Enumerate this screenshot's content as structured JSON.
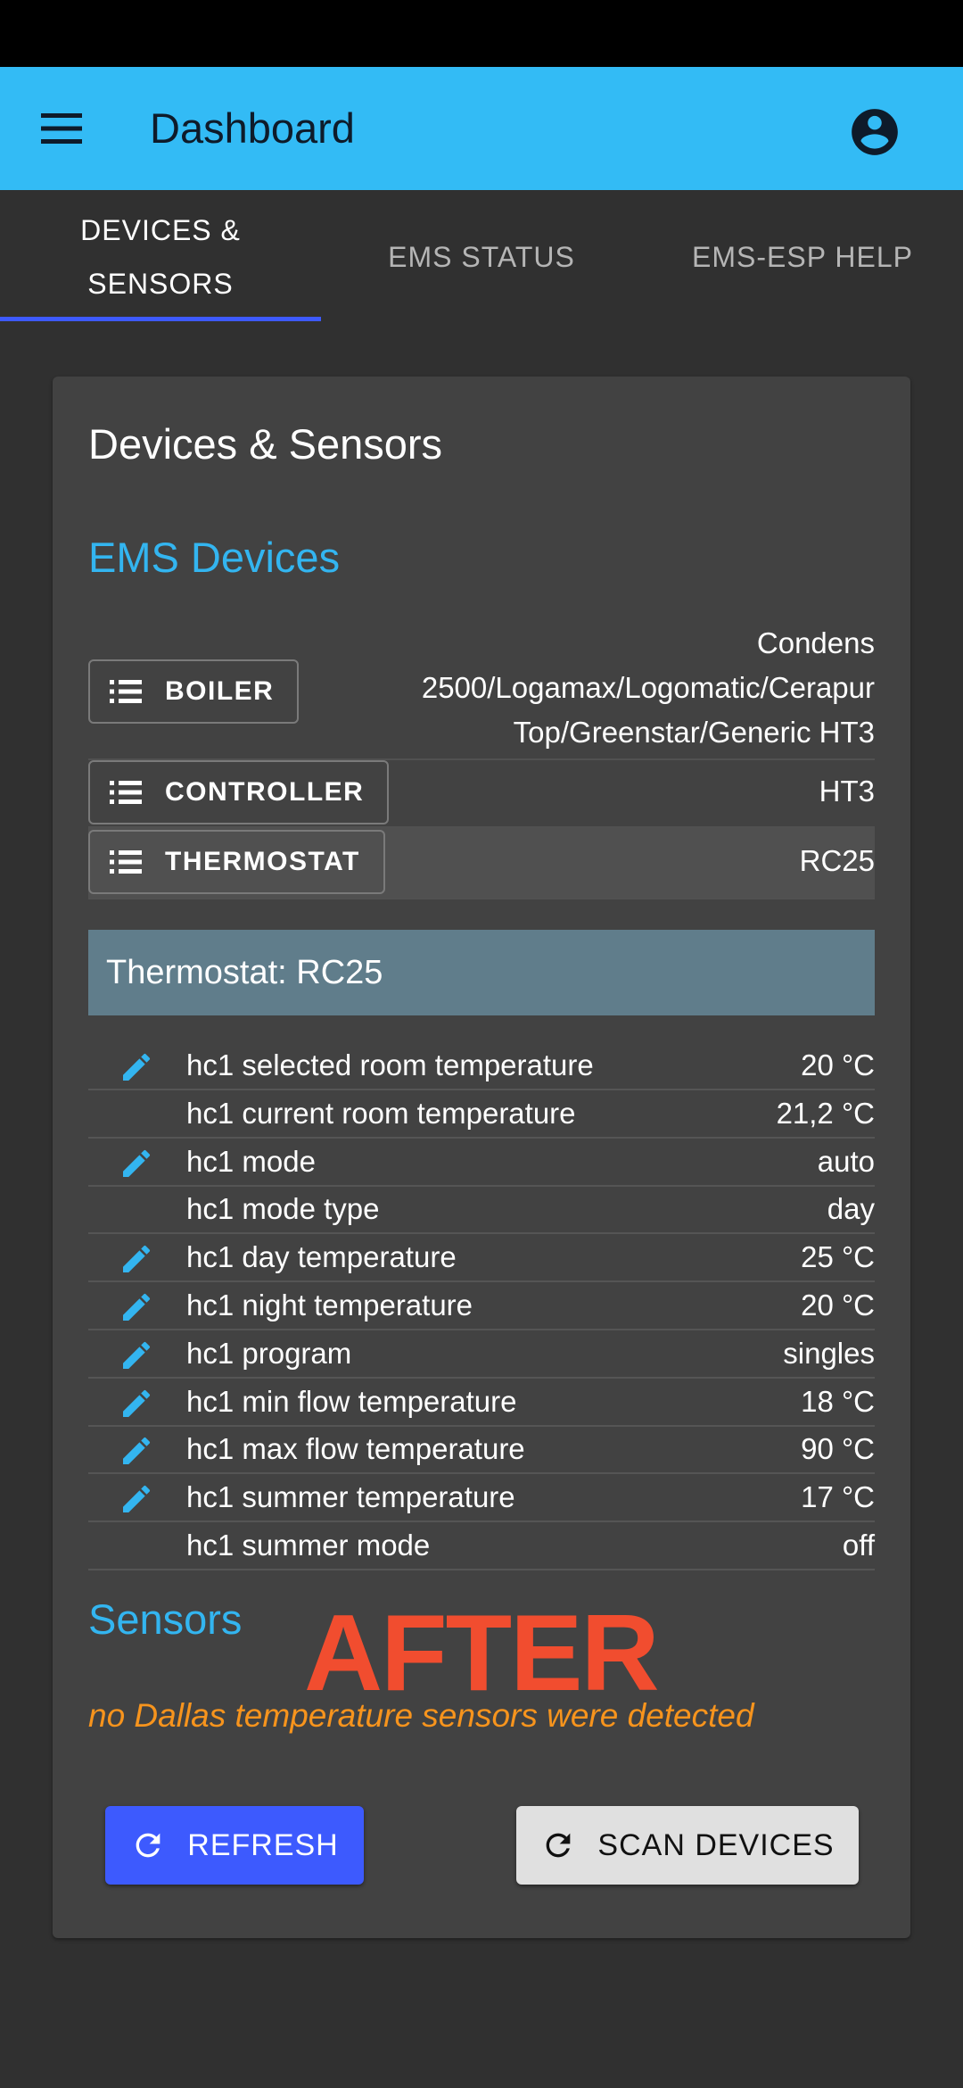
{
  "app_bar": {
    "title": "Dashboard",
    "menu_icon": "menu-icon",
    "account_icon": "account-circle-icon",
    "color": "#33bbf5"
  },
  "tabs": [
    {
      "label_line1": "DEVICES &",
      "label_line2": "SENSORS",
      "active": true
    },
    {
      "label": "EMS STATUS",
      "active": false
    },
    {
      "label": "EMS-ESP HELP",
      "active": false
    }
  ],
  "card": {
    "title": "Devices & Sensors",
    "ems_devices_title": "EMS Devices",
    "devices": [
      {
        "button": "BOILER",
        "name_lines": [
          "Condens",
          "2500/Logamax/Logomatic/Cerapur",
          "Top/Greenstar/Generic HT3"
        ]
      },
      {
        "button": "CONTROLLER",
        "name_lines": [
          "HT3"
        ]
      },
      {
        "button": "THERMOSTAT",
        "name_lines": [
          "RC25"
        ],
        "selected": true
      }
    ],
    "thermostat_header": "Thermostat: RC25",
    "parameters": [
      {
        "name": "hc1 selected room temperature",
        "value": "20 °C",
        "editable": true
      },
      {
        "name": "hc1 current room temperature",
        "value": "21,2 °C",
        "editable": false
      },
      {
        "name": "hc1 mode",
        "value": "auto",
        "editable": true
      },
      {
        "name": "hc1 mode type",
        "value": "day",
        "editable": false
      },
      {
        "name": "hc1 day temperature",
        "value": "25 °C",
        "editable": true
      },
      {
        "name": "hc1 night temperature",
        "value": "20 °C",
        "editable": true
      },
      {
        "name": "hc1 program",
        "value": "singles",
        "editable": true
      },
      {
        "name": "hc1 min flow temperature",
        "value": "18 °C",
        "editable": true
      },
      {
        "name": "hc1 max flow temperature",
        "value": "90 °C",
        "editable": true
      },
      {
        "name": "hc1 summer temperature",
        "value": "17 °C",
        "editable": true
      },
      {
        "name": "hc1 summer mode",
        "value": "off",
        "editable": false
      }
    ],
    "sensors_title": "Sensors",
    "overlay_label": "AFTER",
    "no_sensors_text": "no Dallas temperature sensors were detected",
    "refresh_label": "REFRESH",
    "scan_label": "SCAN DEVICES"
  },
  "colors": {
    "accent_blue": "#33b5f0",
    "primary_button": "#3d5afe",
    "warning_text": "#f7941d",
    "after_label": "#f14d2f"
  }
}
